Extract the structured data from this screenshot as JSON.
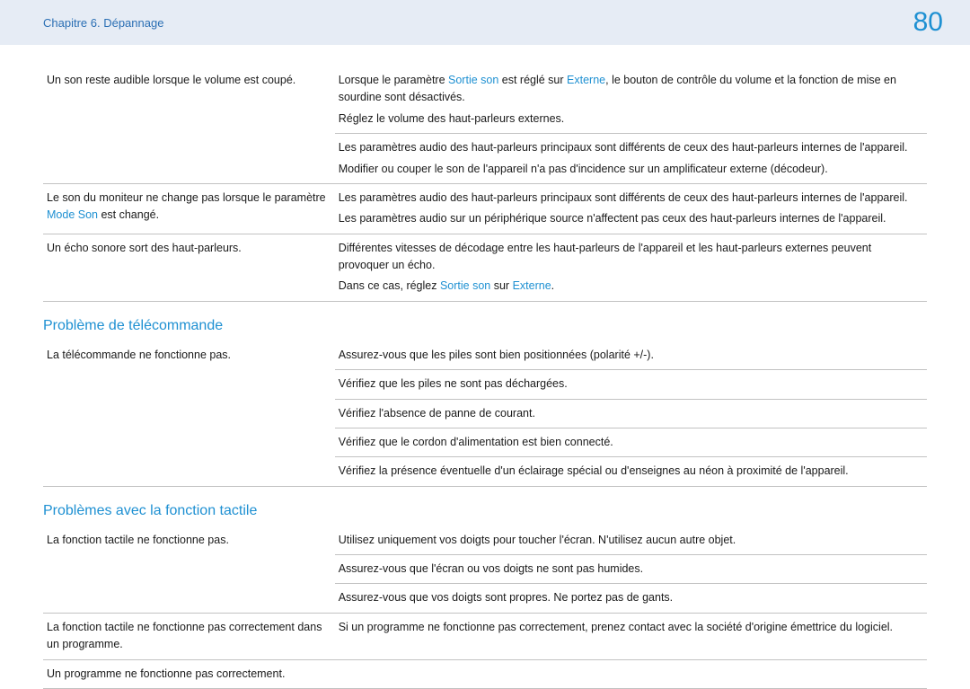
{
  "header": {
    "chapter": "Chapitre 6. Dépannage",
    "page": "80"
  },
  "sound": {
    "rows": [
      {
        "left": "Un son reste audible lorsque le volume est coupé.",
        "right_p1a": "Lorsque le paramètre ",
        "right_p1_kw1": "Sortie son",
        "right_p1b": " est réglé sur ",
        "right_p1_kw2": "Externe",
        "right_p1c": ", le bouton de contrôle du volume et la fonction de mise en sourdine sont désactivés.",
        "right_p2": "Réglez le volume des haut-parleurs externes."
      },
      {
        "left": "",
        "right_p1": "Les paramètres audio des haut-parleurs principaux sont différents de ceux des haut-parleurs internes de l'appareil.",
        "right_p2": "Modifier ou couper le son de l'appareil n'a pas d'incidence sur un amplificateur externe (décodeur)."
      },
      {
        "left_a": "Le son du moniteur ne change pas lorsque le paramètre ",
        "left_kw": "Mode Son",
        "left_b": " est changé.",
        "right_p1": "Les paramètres audio des haut-parleurs principaux sont différents de ceux des haut-parleurs internes de l'appareil.",
        "right_p2": "Les paramètres audio sur un périphérique source n'affectent pas ceux des haut-parleurs internes de l'appareil."
      },
      {
        "left": "Un écho sonore sort des haut-parleurs.",
        "right_p1": "Différentes vitesses de décodage entre les haut-parleurs de l'appareil et les haut-parleurs externes peuvent provoquer un écho.",
        "right_p2a": "Dans ce cas, réglez ",
        "right_p2_kw1": "Sortie son",
        "right_p2b": " sur ",
        "right_p2_kw2": "Externe",
        "right_p2c": "."
      }
    ]
  },
  "section_remote": {
    "title": "Problème de télécommande",
    "left": "La télécommande ne fonctionne pas.",
    "r1": "Assurez-vous que les piles sont bien positionnées (polarité +/-).",
    "r2": "Vérifiez que les piles ne sont pas déchargées.",
    "r3": "Vérifiez l'absence de panne de courant.",
    "r4": "Vérifiez que le cordon d'alimentation est bien connecté.",
    "r5": "Vérifiez la présence éventuelle d'un éclairage spécial ou d'enseignes au néon à proximité de l'appareil."
  },
  "section_touch": {
    "title": "Problèmes avec la fonction tactile",
    "row1_left": "La fonction tactile ne fonctionne pas.",
    "row1_r1": "Utilisez uniquement vos doigts pour toucher l'écran. N'utilisez aucun autre objet.",
    "row1_r2": "Assurez-vous que l'écran ou vos doigts ne sont pas humides.",
    "row1_r3": "Assurez-vous que vos doigts sont propres. Ne portez pas de gants.",
    "row2_left": "La fonction tactile ne fonctionne pas correctement dans un programme.",
    "row2_r": "Si un programme ne fonctionne pas correctement, prenez contact avec la société d'origine émettrice du logiciel.",
    "row3_left": "Un programme ne fonctionne pas correctement.",
    "row3_r": ""
  }
}
